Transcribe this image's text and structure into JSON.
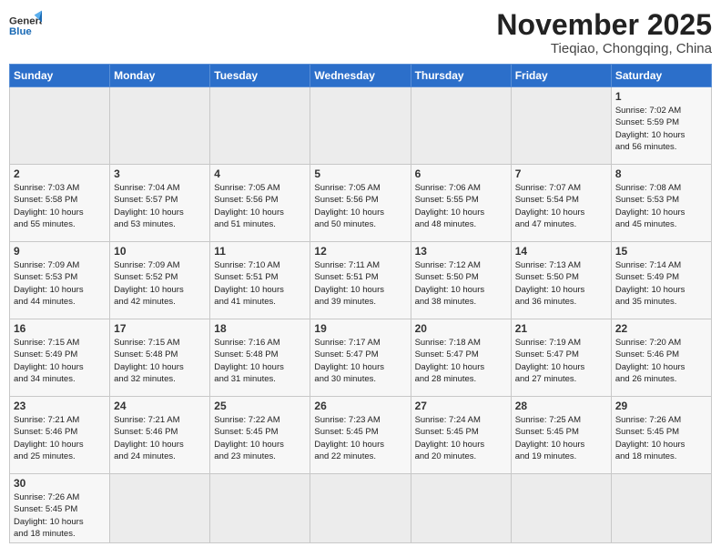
{
  "header": {
    "logo_general": "General",
    "logo_blue": "Blue",
    "month_title": "November 2025",
    "subtitle": "Tieqiao, Chongqing, China"
  },
  "weekdays": [
    "Sunday",
    "Monday",
    "Tuesday",
    "Wednesday",
    "Thursday",
    "Friday",
    "Saturday"
  ],
  "weeks": [
    [
      {
        "day": "",
        "info": ""
      },
      {
        "day": "",
        "info": ""
      },
      {
        "day": "",
        "info": ""
      },
      {
        "day": "",
        "info": ""
      },
      {
        "day": "",
        "info": ""
      },
      {
        "day": "",
        "info": ""
      },
      {
        "day": "1",
        "info": "Sunrise: 7:02 AM\nSunset: 5:59 PM\nDaylight: 10 hours\nand 56 minutes."
      }
    ],
    [
      {
        "day": "2",
        "info": "Sunrise: 7:03 AM\nSunset: 5:58 PM\nDaylight: 10 hours\nand 55 minutes."
      },
      {
        "day": "3",
        "info": "Sunrise: 7:04 AM\nSunset: 5:57 PM\nDaylight: 10 hours\nand 53 minutes."
      },
      {
        "day": "4",
        "info": "Sunrise: 7:05 AM\nSunset: 5:56 PM\nDaylight: 10 hours\nand 51 minutes."
      },
      {
        "day": "5",
        "info": "Sunrise: 7:05 AM\nSunset: 5:56 PM\nDaylight: 10 hours\nand 50 minutes."
      },
      {
        "day": "6",
        "info": "Sunrise: 7:06 AM\nSunset: 5:55 PM\nDaylight: 10 hours\nand 48 minutes."
      },
      {
        "day": "7",
        "info": "Sunrise: 7:07 AM\nSunset: 5:54 PM\nDaylight: 10 hours\nand 47 minutes."
      },
      {
        "day": "8",
        "info": "Sunrise: 7:08 AM\nSunset: 5:53 PM\nDaylight: 10 hours\nand 45 minutes."
      }
    ],
    [
      {
        "day": "9",
        "info": "Sunrise: 7:09 AM\nSunset: 5:53 PM\nDaylight: 10 hours\nand 44 minutes."
      },
      {
        "day": "10",
        "info": "Sunrise: 7:09 AM\nSunset: 5:52 PM\nDaylight: 10 hours\nand 42 minutes."
      },
      {
        "day": "11",
        "info": "Sunrise: 7:10 AM\nSunset: 5:51 PM\nDaylight: 10 hours\nand 41 minutes."
      },
      {
        "day": "12",
        "info": "Sunrise: 7:11 AM\nSunset: 5:51 PM\nDaylight: 10 hours\nand 39 minutes."
      },
      {
        "day": "13",
        "info": "Sunrise: 7:12 AM\nSunset: 5:50 PM\nDaylight: 10 hours\nand 38 minutes."
      },
      {
        "day": "14",
        "info": "Sunrise: 7:13 AM\nSunset: 5:50 PM\nDaylight: 10 hours\nand 36 minutes."
      },
      {
        "day": "15",
        "info": "Sunrise: 7:14 AM\nSunset: 5:49 PM\nDaylight: 10 hours\nand 35 minutes."
      }
    ],
    [
      {
        "day": "16",
        "info": "Sunrise: 7:15 AM\nSunset: 5:49 PM\nDaylight: 10 hours\nand 34 minutes."
      },
      {
        "day": "17",
        "info": "Sunrise: 7:15 AM\nSunset: 5:48 PM\nDaylight: 10 hours\nand 32 minutes."
      },
      {
        "day": "18",
        "info": "Sunrise: 7:16 AM\nSunset: 5:48 PM\nDaylight: 10 hours\nand 31 minutes."
      },
      {
        "day": "19",
        "info": "Sunrise: 7:17 AM\nSunset: 5:47 PM\nDaylight: 10 hours\nand 30 minutes."
      },
      {
        "day": "20",
        "info": "Sunrise: 7:18 AM\nSunset: 5:47 PM\nDaylight: 10 hours\nand 28 minutes."
      },
      {
        "day": "21",
        "info": "Sunrise: 7:19 AM\nSunset: 5:47 PM\nDaylight: 10 hours\nand 27 minutes."
      },
      {
        "day": "22",
        "info": "Sunrise: 7:20 AM\nSunset: 5:46 PM\nDaylight: 10 hours\nand 26 minutes."
      }
    ],
    [
      {
        "day": "23",
        "info": "Sunrise: 7:21 AM\nSunset: 5:46 PM\nDaylight: 10 hours\nand 25 minutes."
      },
      {
        "day": "24",
        "info": "Sunrise: 7:21 AM\nSunset: 5:46 PM\nDaylight: 10 hours\nand 24 minutes."
      },
      {
        "day": "25",
        "info": "Sunrise: 7:22 AM\nSunset: 5:45 PM\nDaylight: 10 hours\nand 23 minutes."
      },
      {
        "day": "26",
        "info": "Sunrise: 7:23 AM\nSunset: 5:45 PM\nDaylight: 10 hours\nand 22 minutes."
      },
      {
        "day": "27",
        "info": "Sunrise: 7:24 AM\nSunset: 5:45 PM\nDaylight: 10 hours\nand 20 minutes."
      },
      {
        "day": "28",
        "info": "Sunrise: 7:25 AM\nSunset: 5:45 PM\nDaylight: 10 hours\nand 19 minutes."
      },
      {
        "day": "29",
        "info": "Sunrise: 7:26 AM\nSunset: 5:45 PM\nDaylight: 10 hours\nand 18 minutes."
      }
    ],
    [
      {
        "day": "30",
        "info": "Sunrise: 7:26 AM\nSunset: 5:45 PM\nDaylight: 10 hours\nand 18 minutes."
      },
      {
        "day": "",
        "info": ""
      },
      {
        "day": "",
        "info": ""
      },
      {
        "day": "",
        "info": ""
      },
      {
        "day": "",
        "info": ""
      },
      {
        "day": "",
        "info": ""
      },
      {
        "day": "",
        "info": ""
      }
    ]
  ]
}
